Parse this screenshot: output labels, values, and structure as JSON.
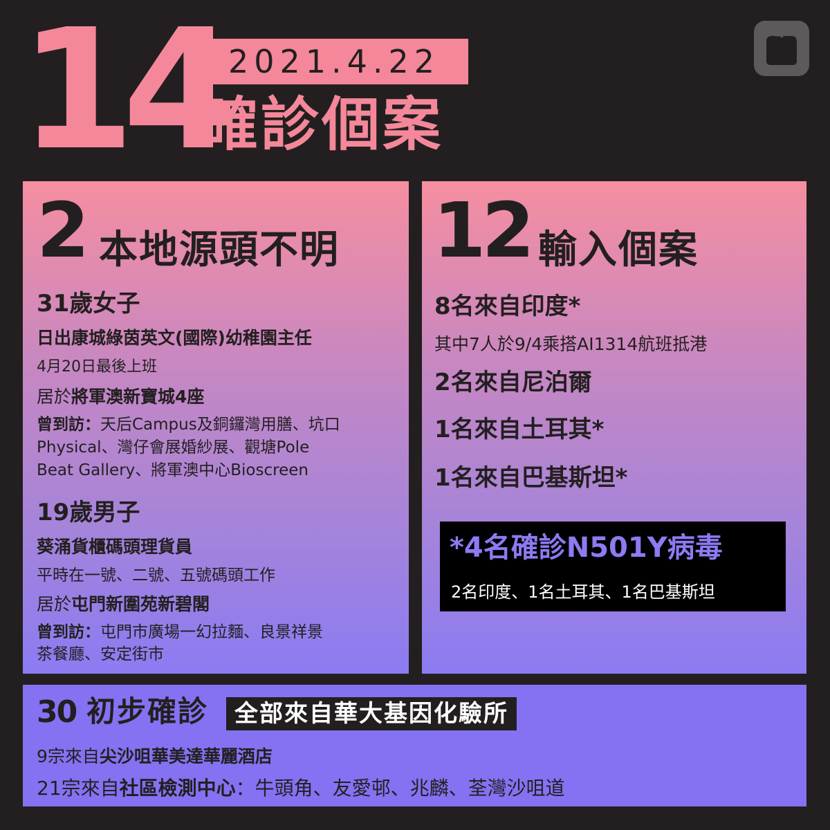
{
  "header": {
    "total": "14",
    "date": "2021.4.22",
    "title": "確診個案"
  },
  "local": {
    "count": "2",
    "label": "本地源頭不明",
    "case1": {
      "title": "31歲女子",
      "role": "日出康城綠茵英文(國際)幼稚園主任",
      "last_work": "4月20日最後上班",
      "residence_prefix": "居於",
      "residence": "將軍澳新寶城4座",
      "visited_label": "曾到訪：",
      "visited_line1": "天后Campus及銅鑼灣用膳、坑口",
      "visited_line2": "Physical、灣仔會展婚紗展、觀塘Pole",
      "visited_line3": "Beat Gallery、將軍澳中心Bioscreen"
    },
    "case2": {
      "title": "19歲男子",
      "role": "葵涌貨櫃碼頭理貨員",
      "work": "平時在一號、二號、五號碼頭工作",
      "residence_prefix": "居於",
      "residence": "屯門新圍苑新碧閣",
      "visited_label": "曾到訪：",
      "visited_line1": "屯門市廣場一幻拉麵、良景祥景",
      "visited_line2": "茶餐廳、安定街市"
    }
  },
  "imported": {
    "count": "12",
    "label": "輸入個案",
    "items": [
      "8名來自印度*",
      "2名來自尼泊爾",
      "1名來自土耳其*",
      "1名來自巴基斯坦*"
    ],
    "india_note": "其中7人於9/4乘搭AI1314航班抵港",
    "variant_title": "*4名確診N501Y病毒",
    "variant_detail": "2名印度、1名土耳其、1名巴基斯坦"
  },
  "preliminary": {
    "count": "30",
    "label": "初步確診",
    "tag": "全部來自華大基因化驗所",
    "line1_prefix": "9宗來自",
    "line1_place": "尖沙咀華美達華麗酒店",
    "line2_prefix": "21宗來自",
    "line2_place": "社區檢測中心",
    "line2_suffix": "：牛頭角、友愛邨、兆麟、荃灣沙咀道"
  },
  "logo": {
    "icon": "apple-daily-logo"
  },
  "colors": {
    "pink": "#f4889a",
    "purple": "#8472f2",
    "dark": "#231f20"
  }
}
